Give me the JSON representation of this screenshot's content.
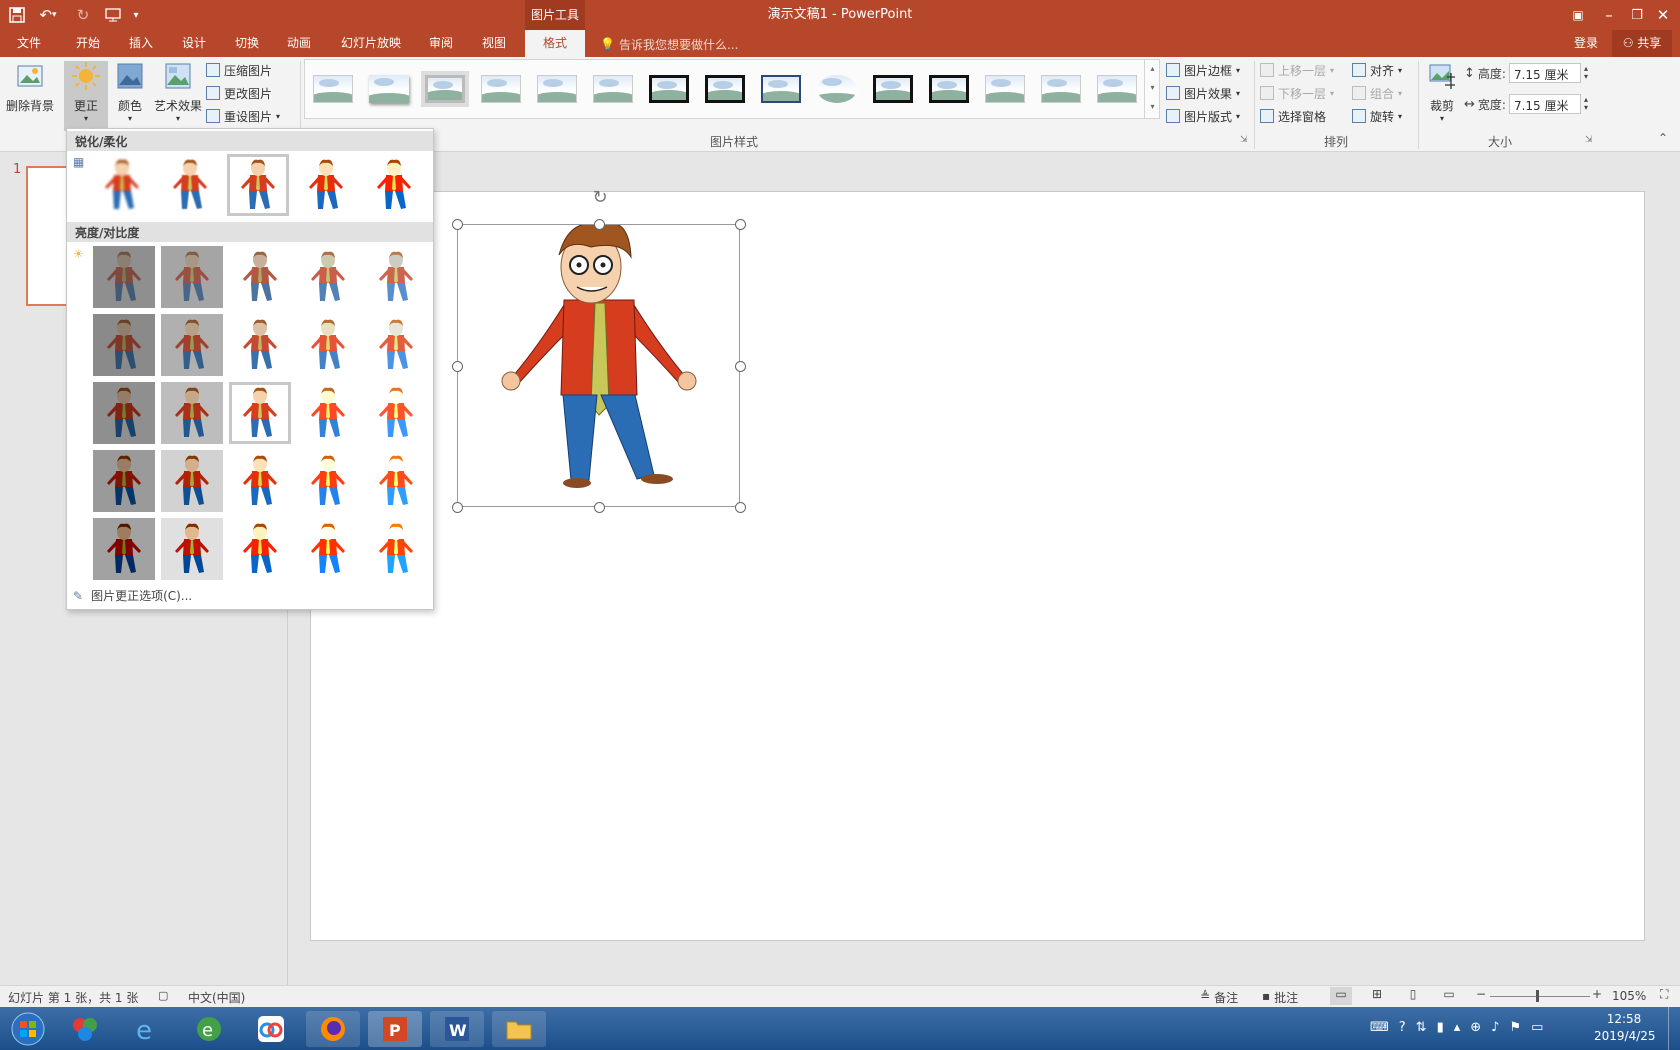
{
  "app": {
    "title": "演示文稿1 - PowerPoint",
    "context_tab_header": "图片工具",
    "window_controls": [
      "restore-ribbon",
      "minimize",
      "maximize",
      "close"
    ]
  },
  "qat": {
    "items": [
      "save-icon",
      "undo-icon",
      "redo-icon",
      "start-slideshow-icon",
      "customize-icon"
    ]
  },
  "tabs": [
    {
      "label": "文件",
      "active": false
    },
    {
      "label": "开始",
      "active": false
    },
    {
      "label": "插入",
      "active": false
    },
    {
      "label": "设计",
      "active": false
    },
    {
      "label": "切换",
      "active": false
    },
    {
      "label": "动画",
      "active": false
    },
    {
      "label": "幻灯片放映",
      "active": false
    },
    {
      "label": "审阅",
      "active": false
    },
    {
      "label": "视图",
      "active": false
    },
    {
      "label": "格式",
      "active": true
    }
  ],
  "tell_me": "告诉我您想要做什么...",
  "account": {
    "signin": "登录",
    "share": "共享"
  },
  "ribbon": {
    "adjust": {
      "remove_bg": "删除背景",
      "corrections": "更正",
      "color": "颜色",
      "artistic": "艺术效果",
      "compress": "压缩图片",
      "change": "更改图片",
      "reset": "重设图片"
    },
    "styles": {
      "group_label": "图片样式",
      "border": "图片边框",
      "effects": "图片效果",
      "layout": "图片版式",
      "thumb_count": 15
    },
    "arrange": {
      "group_label": "排列",
      "bring_forward": "上移一层",
      "send_backward": "下移一层",
      "selection_pane": "选择窗格",
      "align": "对齐",
      "group": "组合",
      "rotate": "旋转"
    },
    "size": {
      "group_label": "大小",
      "crop": "裁剪",
      "height_label": "高度:",
      "height_value": "7.15 厘米",
      "width_label": "宽度:",
      "width_value": "7.15 厘米"
    }
  },
  "dropdown": {
    "sharpen_header": "锐化/柔化",
    "brightness_header": "亮度/对比度",
    "options_link": "图片更正选项(C)...",
    "sharpen_selected_index": 2,
    "brightness_selected": {
      "row": 2,
      "col": 2
    }
  },
  "thumbnail_pane": {
    "slide_number": "1"
  },
  "statusbar": {
    "slide_info": "幻灯片 第 1 张，共 1 张",
    "language": "中文(中国)",
    "notes": "备注",
    "comments": "批注",
    "zoom": "105%"
  },
  "taskbar": {
    "apps": [
      "start-orb",
      "app-icon",
      "ie-icon",
      "browser-icon",
      "baidu-netdisk-icon",
      "firefox-icon",
      "powerpoint-icon",
      "word-icon",
      "file-explorer-icon"
    ],
    "time": "12:58",
    "date": "2019/4/25"
  },
  "colors": {
    "accent": "#b7472a",
    "ribbon_bg": "#f3f3f3",
    "canvas_bg": "#ffffff"
  }
}
